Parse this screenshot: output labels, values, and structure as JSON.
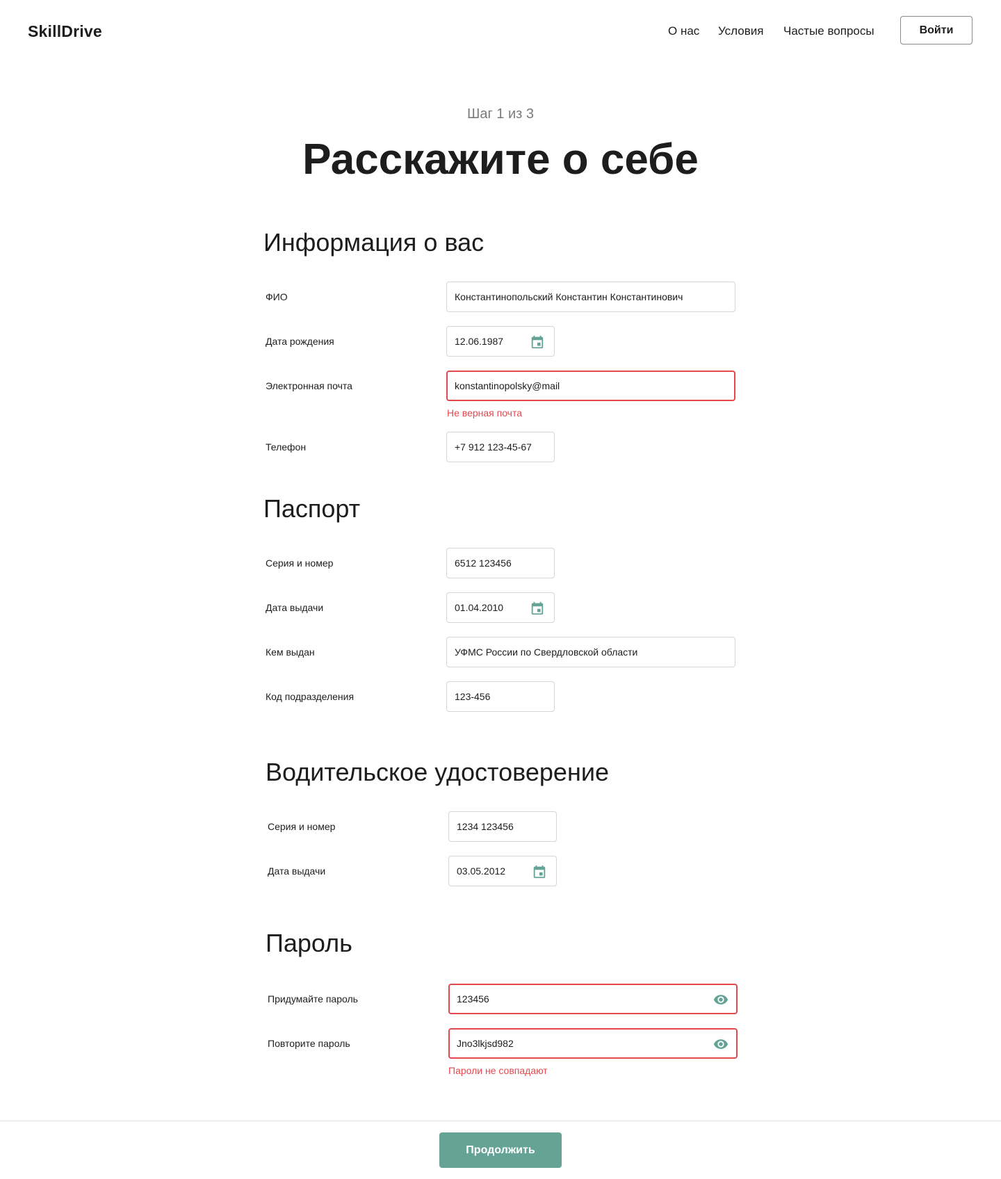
{
  "header": {
    "logo": "SkillDrive",
    "nav": [
      "О нас",
      "Условия",
      "Частые вопросы"
    ],
    "login_label": "Войти"
  },
  "page": {
    "step": "Шаг 1 из 3",
    "title": "Расскажите о себе"
  },
  "personal": {
    "title": "Информация о вас",
    "fio_label": "ФИО",
    "fio_value": "Константинопольский Константин Константинович",
    "birth_label": "Дата рождения",
    "birth_value": "12.06.1987",
    "email_label": "Электронная почта",
    "email_value": "konstantinopolsky@mail",
    "email_error": "Не верная почта",
    "phone_label": "Телефон",
    "phone_value": "+7 912 123-45-67"
  },
  "passport": {
    "title": "Паспорт",
    "number_label": "Серия и номер",
    "number_value": "6512 123456",
    "date_label": "Дата выдачи",
    "date_value": "01.04.2010",
    "issuer_label": "Кем выдан",
    "issuer_value": "УФМС России по Свердловской области",
    "code_label": "Код подразделения",
    "code_value": "123-456"
  },
  "license": {
    "title": "Водительское удостоверение",
    "number_label": "Серия и номер",
    "number_value": "1234 123456",
    "date_label": "Дата выдачи",
    "date_value": "03.05.2012"
  },
  "password": {
    "title": "Пароль",
    "new_label": "Придумайте пароль",
    "new_value": "123456",
    "repeat_label": "Повторите пароль",
    "repeat_value": "Jno3lkjsd982",
    "error": "Пароли не совпадают"
  },
  "footer": {
    "continue_label": "Продолжить"
  },
  "colors": {
    "accent": "#65a396",
    "error": "#e5484d",
    "border": "#d5d5d5",
    "text": "#1d1d1d",
    "muted": "#7a7a7a"
  },
  "icons": {
    "calendar": "calendar-icon",
    "eye": "eye-icon"
  }
}
